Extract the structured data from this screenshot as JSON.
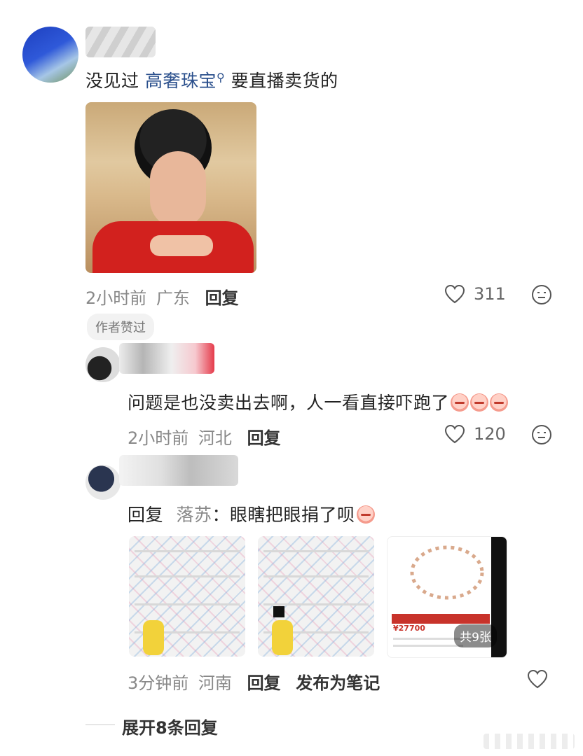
{
  "comment1": {
    "text_prefix": "没见过",
    "link": "高奢珠宝",
    "text_suffix": "要直播卖货的",
    "time": "2小时前",
    "location": "广东",
    "reply_label": "回复",
    "likes": "311",
    "badge": "作者赞过"
  },
  "reply1": {
    "text": "问题是也没卖出去啊，人一看直接吓跑了",
    "time": "2小时前",
    "location": "河北",
    "reply_label": "回复",
    "likes": "120"
  },
  "reply2": {
    "reply_word": "回复",
    "target_user": "落苏",
    "text": "：眼瞎把眼捐了呗",
    "time": "3分钟前",
    "location": "河南",
    "reply_label": "回复",
    "publish_label": "发布为笔记",
    "image_count": "共9张",
    "price": "¥27700"
  },
  "expand_replies": "展开8条回复",
  "colors": {
    "link": "#2a4f8c",
    "text": "#222222",
    "meta": "#888888"
  },
  "icons": [
    "heart-icon",
    "dislike-face-icon",
    "search-icon"
  ]
}
